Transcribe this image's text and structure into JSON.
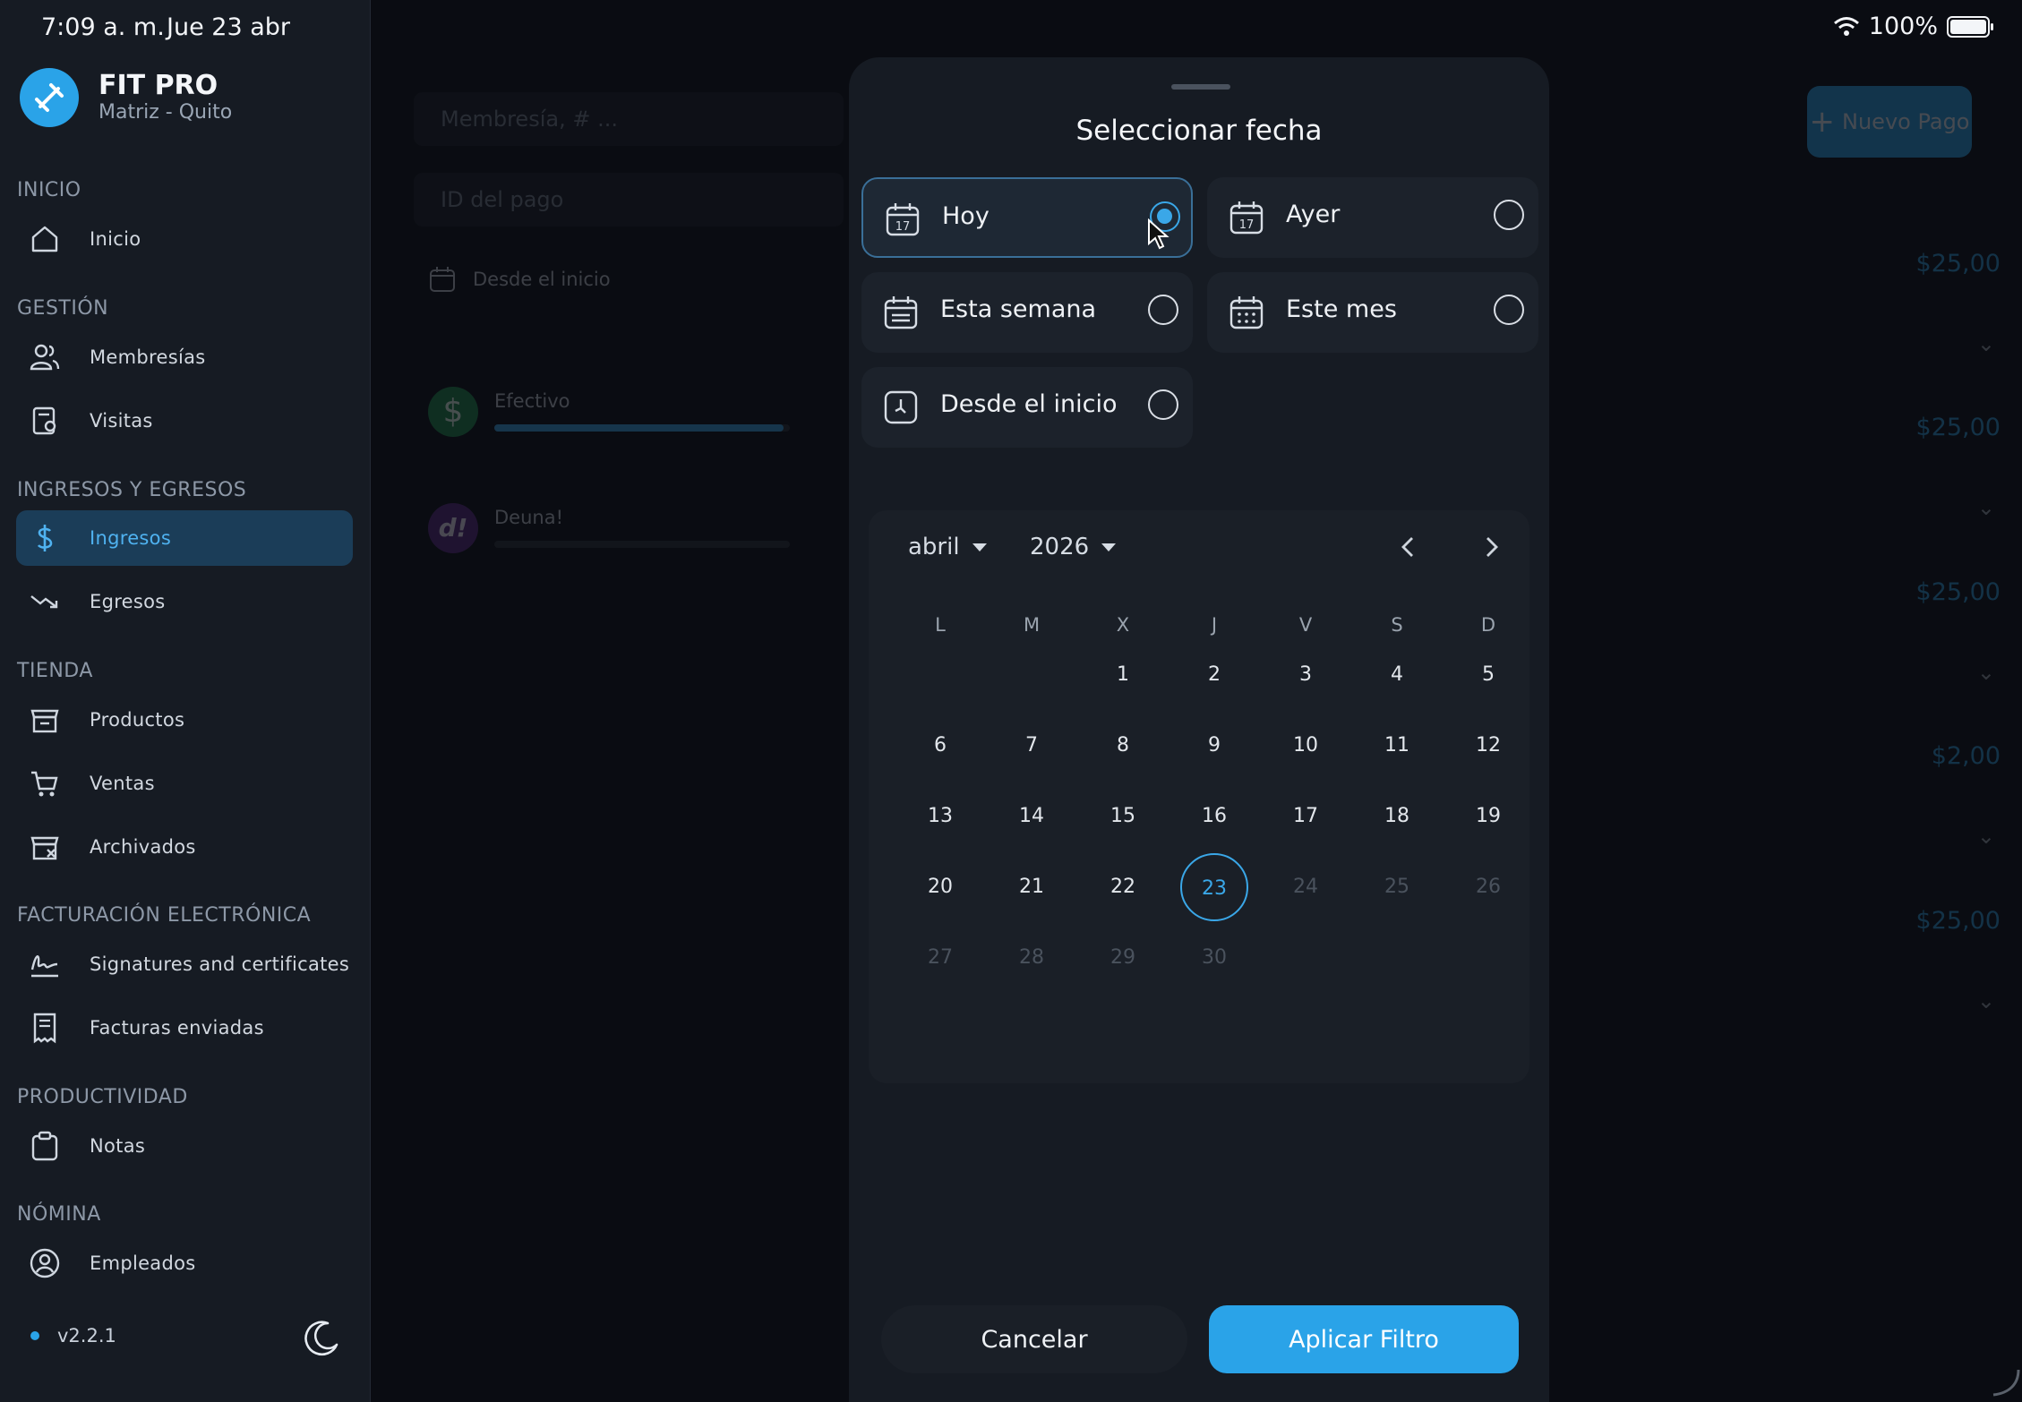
{
  "status_bar": {
    "time": "7:09 a. m.",
    "date": "Jue 23 abr",
    "battery": "100%"
  },
  "brand": {
    "name": "FIT PRO",
    "branch": "Matriz - Quito"
  },
  "sidebar": {
    "sections": {
      "inicio": "INICIO",
      "gestion": "GESTIÓN",
      "ingresos_egresos": "INGRESOS Y EGRESOS",
      "tienda": "TIENDA",
      "facturacion": "FACTURACIÓN ELECTRÓNICA",
      "productividad": "PRODUCTIVIDAD",
      "nomina": "NÓMINA"
    },
    "items": {
      "inicio": "Inicio",
      "membresias": "Membresías",
      "visitas": "Visitas",
      "ingresos": "Ingresos",
      "egresos": "Egresos",
      "productos": "Productos",
      "ventas": "Ventas",
      "archivados": "Archivados",
      "signatures": "Signatures and certificates",
      "facturas": "Facturas enviadas",
      "notas": "Notas",
      "empleados": "Empleados"
    },
    "active_item": "Ingresos",
    "version": "v2.2.1"
  },
  "main": {
    "search_membership_placeholder": "Membresía, # ...",
    "payment_id_placeholder": "ID del pago",
    "date_filter_label": "Desde el inicio",
    "new_payment_label": "Nuevo Pago",
    "methods": [
      {
        "name": "Efectivo",
        "progress": 0.98
      },
      {
        "name": "Deuna!",
        "progress": 0.0
      }
    ],
    "amounts": [
      "$25,00",
      "$25,00",
      "$25,00",
      "$2,00",
      "$25,00"
    ]
  },
  "modal": {
    "title": "Seleccionar fecha",
    "options": [
      {
        "label": "Hoy",
        "selected": true
      },
      {
        "label": "Ayer",
        "selected": false
      },
      {
        "label": "Esta semana",
        "selected": false
      },
      {
        "label": "Este mes",
        "selected": false
      },
      {
        "label": "Desde el inicio",
        "selected": false
      }
    ],
    "calendar": {
      "month": "abril",
      "year": "2026",
      "weekdays": [
        "L",
        "M",
        "X",
        "J",
        "V",
        "S",
        "D"
      ],
      "first_weekday_index": 2,
      "days_in_month": 30,
      "today": 23
    },
    "cancel_label": "Cancelar",
    "apply_label": "Aplicar Filtro"
  },
  "colors": {
    "accent": "#2aa3e8",
    "background": "#0c0f14",
    "panel": "#161b23"
  }
}
